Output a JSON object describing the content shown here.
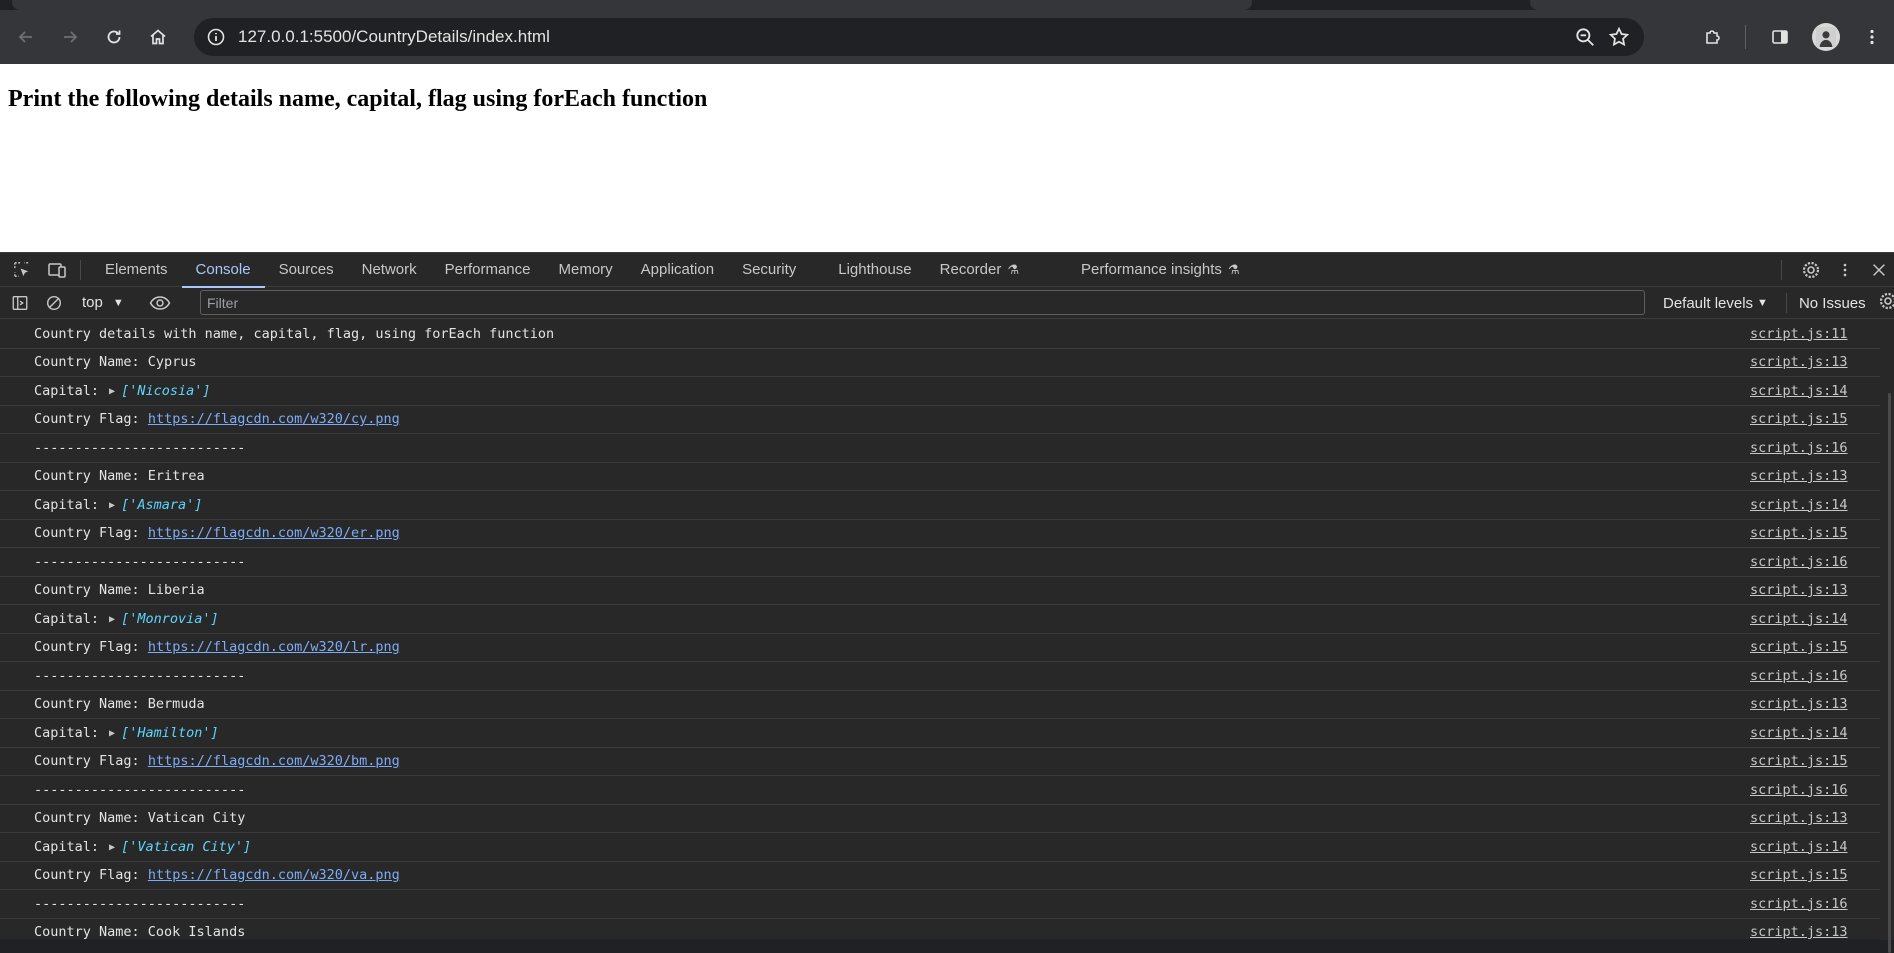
{
  "browser": {
    "url": "127.0.0.1:5500/CountryDetails/index.html"
  },
  "page": {
    "heading": "Print the following details name, capital, flag using forEach function"
  },
  "devtools": {
    "tabs": [
      {
        "label": "Elements"
      },
      {
        "label": "Console"
      },
      {
        "label": "Sources"
      },
      {
        "label": "Network"
      },
      {
        "label": "Performance"
      },
      {
        "label": "Memory"
      },
      {
        "label": "Application"
      },
      {
        "label": "Security"
      },
      {
        "label": "Lighthouse"
      },
      {
        "label": "Recorder"
      },
      {
        "label": "Performance insights"
      }
    ],
    "active_tab": "Console",
    "console_toolbar": {
      "context": "top",
      "filter_placeholder": "Filter",
      "levels": "Default levels",
      "issues": "No Issues"
    },
    "log": [
      {
        "kind": "text",
        "text": "Country details with name, capital, flag, using forEach function",
        "source": "script.js:11"
      },
      {
        "kind": "text",
        "text": "Country Name: Cyprus",
        "source": "script.js:13"
      },
      {
        "kind": "capital",
        "prefix": "Capital:",
        "value": "['Nicosia']",
        "source": "script.js:14"
      },
      {
        "kind": "flag",
        "prefix": "Country Flag:",
        "url": "https://flagcdn.com/w320/cy.png",
        "source": "script.js:15"
      },
      {
        "kind": "text",
        "text": "--------------------------",
        "source": "script.js:16"
      },
      {
        "kind": "text",
        "text": "Country Name: Eritrea",
        "source": "script.js:13"
      },
      {
        "kind": "capital",
        "prefix": "Capital:",
        "value": "['Asmara']",
        "source": "script.js:14"
      },
      {
        "kind": "flag",
        "prefix": "Country Flag:",
        "url": "https://flagcdn.com/w320/er.png",
        "source": "script.js:15"
      },
      {
        "kind": "text",
        "text": "--------------------------",
        "source": "script.js:16"
      },
      {
        "kind": "text",
        "text": "Country Name: Liberia",
        "source": "script.js:13"
      },
      {
        "kind": "capital",
        "prefix": "Capital:",
        "value": "['Monrovia']",
        "source": "script.js:14"
      },
      {
        "kind": "flag",
        "prefix": "Country Flag:",
        "url": "https://flagcdn.com/w320/lr.png",
        "source": "script.js:15"
      },
      {
        "kind": "text",
        "text": "--------------------------",
        "source": "script.js:16"
      },
      {
        "kind": "text",
        "text": "Country Name: Bermuda",
        "source": "script.js:13"
      },
      {
        "kind": "capital",
        "prefix": "Capital:",
        "value": "['Hamilton']",
        "source": "script.js:14"
      },
      {
        "kind": "flag",
        "prefix": "Country Flag:",
        "url": "https://flagcdn.com/w320/bm.png",
        "source": "script.js:15"
      },
      {
        "kind": "text",
        "text": "--------------------------",
        "source": "script.js:16"
      },
      {
        "kind": "text",
        "text": "Country Name: Vatican City",
        "source": "script.js:13"
      },
      {
        "kind": "capital",
        "prefix": "Capital:",
        "value": "['Vatican City']",
        "source": "script.js:14"
      },
      {
        "kind": "flag",
        "prefix": "Country Flag:",
        "url": "https://flagcdn.com/w320/va.png",
        "source": "script.js:15"
      },
      {
        "kind": "text",
        "text": "--------------------------",
        "source": "script.js:16"
      },
      {
        "kind": "text",
        "text": "Country Name: Cook Islands",
        "source": "script.js:13"
      }
    ]
  }
}
